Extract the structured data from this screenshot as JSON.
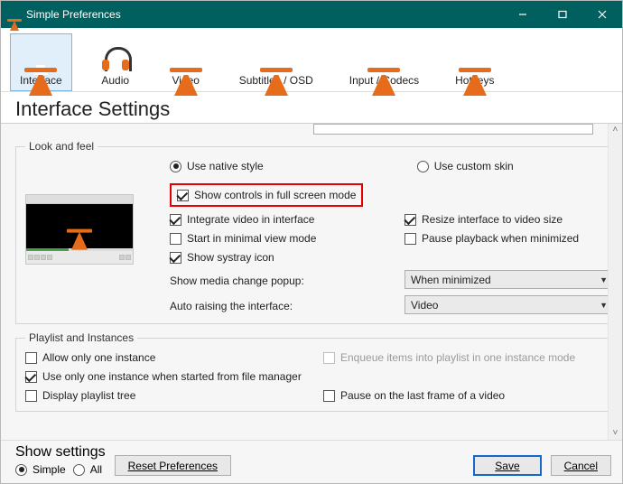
{
  "window": {
    "title": "Simple Preferences"
  },
  "tabs": [
    {
      "label": "Interface"
    },
    {
      "label": "Audio"
    },
    {
      "label": "Video"
    },
    {
      "label": "Subtitles / OSD"
    },
    {
      "label": "Input / Codecs"
    },
    {
      "label": "Hotkeys"
    }
  ],
  "page_heading": "Interface Settings",
  "look": {
    "legend": "Look and feel",
    "native_style": "Use native style",
    "custom_skin": "Use custom skin",
    "show_controls_fullscreen": "Show controls in full screen mode",
    "integrate_video": "Integrate video in interface",
    "resize_to_video": "Resize interface to video size",
    "start_minimal": "Start in minimal view mode",
    "pause_minimized": "Pause playback when minimized",
    "show_systray": "Show systray icon",
    "media_change_label": "Show media change popup:",
    "media_change_value": "When minimized",
    "auto_raise_label": "Auto raising the interface:",
    "auto_raise_value": "Video"
  },
  "playlist": {
    "legend": "Playlist and Instances",
    "allow_only_one": "Allow only one instance",
    "enqueue_one_instance": "Enqueue items into playlist in one instance mode",
    "one_instance_fm": "Use only one instance when started from file manager",
    "display_tree": "Display playlist tree",
    "pause_last_frame": "Pause on the last frame of a video"
  },
  "footer": {
    "show_settings_label": "Show settings",
    "simple": "Simple",
    "all": "All",
    "reset": "Reset Preferences",
    "save": "Save",
    "cancel": "Cancel"
  }
}
